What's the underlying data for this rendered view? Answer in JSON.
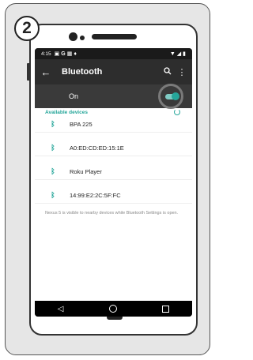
{
  "step_number": "2",
  "status_bar": {
    "time": "4:15",
    "icons_left": [
      "sim-icon",
      "google-icon",
      "image-icon",
      "location-icon"
    ],
    "icons_right": [
      "wifi-icon",
      "signal-icon",
      "battery-icon"
    ]
  },
  "app_bar": {
    "title": "Bluetooth"
  },
  "bluetooth_toggle": {
    "label": "On",
    "state": true,
    "accent_color": "#26a69a"
  },
  "available_devices": {
    "header": "Available devices",
    "devices": [
      {
        "name": "BPA 225"
      },
      {
        "name": "A0:ED:CD:ED:15:1E"
      },
      {
        "name": "Roku Player"
      },
      {
        "name": "14:99:E2:2C:5F:FC"
      }
    ]
  },
  "visibility_note": "Nexus 5 is visible to nearby devices while Bluetooth Settings is open."
}
